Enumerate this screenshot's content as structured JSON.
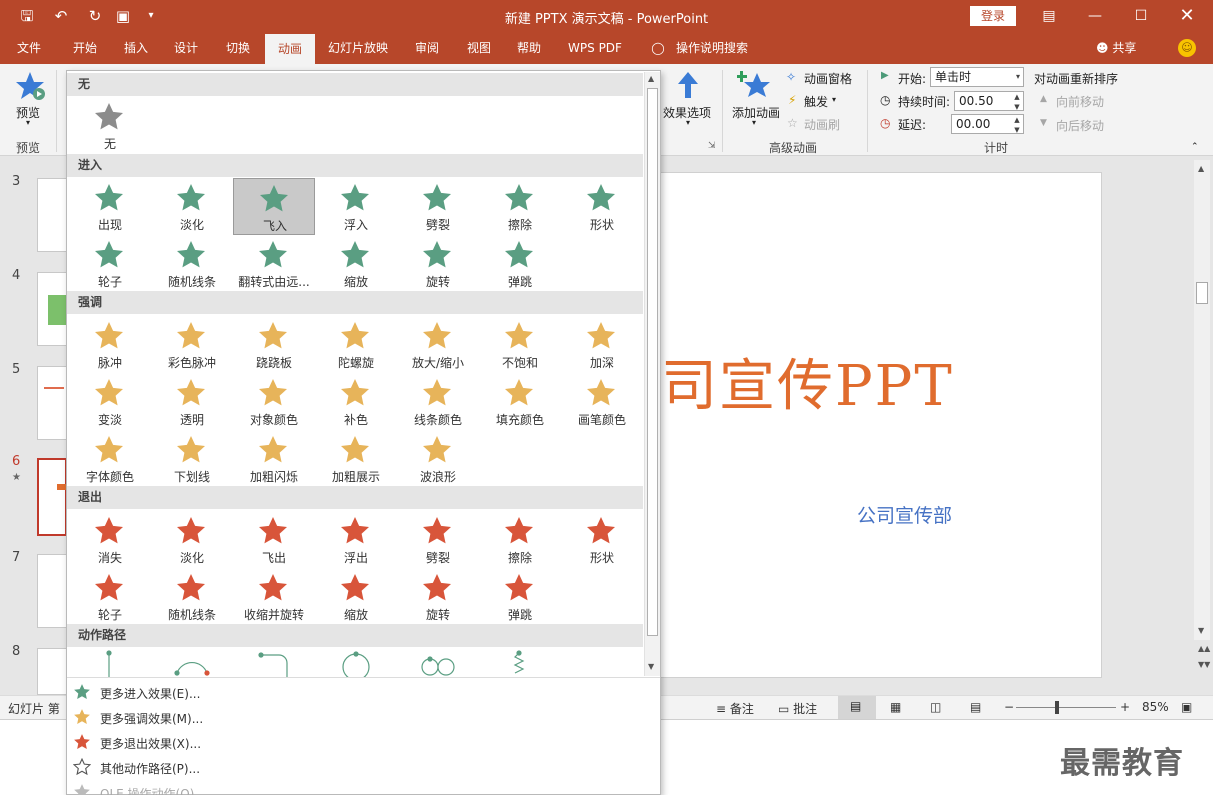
{
  "app": {
    "title": "新建 PPTX 演示文稿 - PowerPoint",
    "login_label": "登录",
    "share_label": "共享"
  },
  "tabs": [
    {
      "label": "文件"
    },
    {
      "label": "开始"
    },
    {
      "label": "插入"
    },
    {
      "label": "设计"
    },
    {
      "label": "切换"
    },
    {
      "label": "动画"
    },
    {
      "label": "幻灯片放映"
    },
    {
      "label": "审阅"
    },
    {
      "label": "视图"
    },
    {
      "label": "帮助"
    },
    {
      "label": "WPS PDF"
    },
    {
      "label": "操作说明搜索"
    }
  ],
  "ribbon": {
    "preview_button": "预览",
    "preview_group": "预览",
    "effect_options": "效果选项",
    "add_animation": "添加动画",
    "animation_pane": "动画窗格",
    "trigger": "触发",
    "animation_painter": "动画刷",
    "advanced_group": "高级动画",
    "start_label": "开始:",
    "start_value": "单击时",
    "duration_label": "持续时间:",
    "duration_value": "00.50",
    "delay_label": "延迟:",
    "delay_value": "00.00",
    "timing_group": "计时",
    "reorder_label": "对动画重新排序",
    "move_earlier": "向前移动",
    "move_later": "向后移动"
  },
  "slides": {
    "numbers": [
      "3",
      "4",
      "5",
      "6",
      "7",
      "8"
    ]
  },
  "slide": {
    "title": "司宣传PPT",
    "subtitle": "公司宣传部"
  },
  "status": {
    "slide_label": "幻灯片 第",
    "notes": "备注",
    "comments": "批注",
    "zoom": "85%"
  },
  "animation_panel": {
    "none_header": "无",
    "none_label": "无",
    "entrance_header": "进入",
    "entrance": [
      "出现",
      "淡化",
      "飞入",
      "浮入",
      "劈裂",
      "擦除",
      "形状",
      "轮子",
      "随机线条",
      "翻转式由远...",
      "缩放",
      "旋转",
      "弹跳"
    ],
    "entrance_selected": "飞入",
    "emphasis_header": "强调",
    "emphasis": [
      "脉冲",
      "彩色脉冲",
      "跷跷板",
      "陀螺旋",
      "放大/缩小",
      "不饱和",
      "加深",
      "变淡",
      "透明",
      "对象颜色",
      "补色",
      "线条颜色",
      "填充颜色",
      "画笔颜色",
      "字体颜色",
      "下划线",
      "加粗闪烁",
      "加粗展示",
      "波浪形"
    ],
    "exit_header": "退出",
    "exit": [
      "消失",
      "淡化",
      "飞出",
      "浮出",
      "劈裂",
      "擦除",
      "形状",
      "轮子",
      "随机线条",
      "收缩并旋转",
      "缩放",
      "旋转",
      "弹跳"
    ],
    "motion_header": "动作路径",
    "more": [
      {
        "label": "更多进入效果(E)..."
      },
      {
        "label": "更多强调效果(M)..."
      },
      {
        "label": "更多退出效果(X)..."
      },
      {
        "label": "其他动作路径(P)..."
      },
      {
        "label": "OLE 操作动作(O)..."
      }
    ]
  },
  "watermark": "最需教育",
  "colors": {
    "accent": "#b7472a",
    "entrance_star": "#5a9e82",
    "emphasis_star": "#e7b45a",
    "exit_star": "#d8553a",
    "none_star": "#8c8c8c"
  }
}
